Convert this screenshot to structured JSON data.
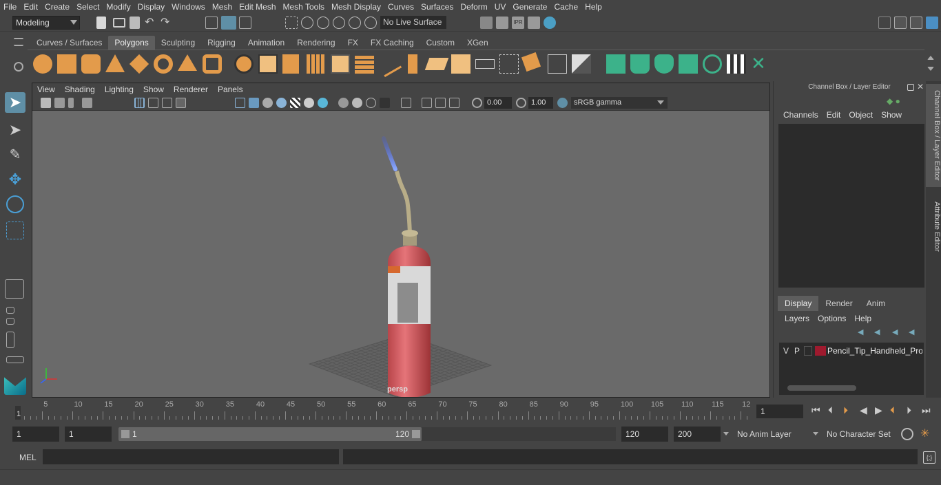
{
  "menu": [
    "File",
    "Edit",
    "Create",
    "Select",
    "Modify",
    "Display",
    "Windows",
    "Mesh",
    "Edit Mesh",
    "Mesh Tools",
    "Mesh Display",
    "Curves",
    "Surfaces",
    "Deform",
    "UV",
    "Generate",
    "Cache",
    "Help"
  ],
  "status": {
    "mode": "Modeling",
    "live_surface": "No Live Surface"
  },
  "shelf_tabs": [
    "Curves / Surfaces",
    "Polygons",
    "Sculpting",
    "Rigging",
    "Animation",
    "Rendering",
    "FX",
    "FX Caching",
    "Custom",
    "XGen"
  ],
  "shelf_active": "Polygons",
  "viewport": {
    "menu": [
      "View",
      "Shading",
      "Lighting",
      "Show",
      "Renderer",
      "Panels"
    ],
    "exposure": "0.00",
    "gamma": "1.00",
    "colorspace": "sRGB gamma",
    "camera_label": "persp"
  },
  "channel_box": {
    "title": "Channel Box / Layer Editor",
    "menu": [
      "Channels",
      "Edit",
      "Object",
      "Show"
    ]
  },
  "layer_editor": {
    "tabs": [
      "Display",
      "Render",
      "Anim"
    ],
    "active_tab": "Display",
    "menu": [
      "Layers",
      "Options",
      "Help"
    ],
    "layers": [
      {
        "v": "V",
        "p": "P",
        "name": "Pencil_Tip_Handheld_Propa",
        "color": "#9e1a2e"
      }
    ]
  },
  "side_tabs": [
    "Channel Box / Layer Editor",
    "Attribute Editor"
  ],
  "timeline": {
    "labels": [
      "5",
      "10",
      "15",
      "20",
      "25",
      "30",
      "35",
      "40",
      "45",
      "50",
      "55",
      "60",
      "65",
      "70",
      "75",
      "80",
      "85",
      "90",
      "95",
      "100",
      "105",
      "110",
      "115",
      "12"
    ],
    "start_marker": "1",
    "current_frame": "1"
  },
  "range": {
    "start": "1",
    "playback_start": "1",
    "slider_start": "1",
    "slider_end": "120",
    "playback_end": "120",
    "end": "200",
    "anim_layer": "No Anim Layer",
    "character_set": "No Character Set"
  },
  "cmd": {
    "label": "MEL"
  }
}
